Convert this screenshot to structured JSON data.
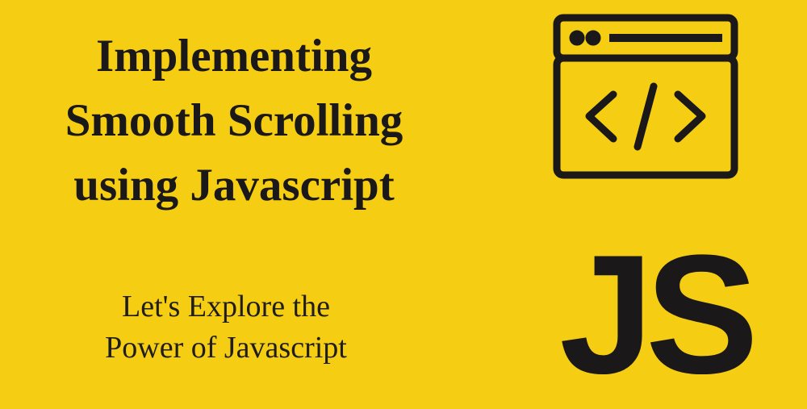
{
  "title_line1": "Implementing",
  "title_line2": "Smooth  Scrolling",
  "title_line3": "using Javascript",
  "subtitle_line1": "Let's Explore the",
  "subtitle_line2": "Power of Javascript",
  "js_label": "JS"
}
